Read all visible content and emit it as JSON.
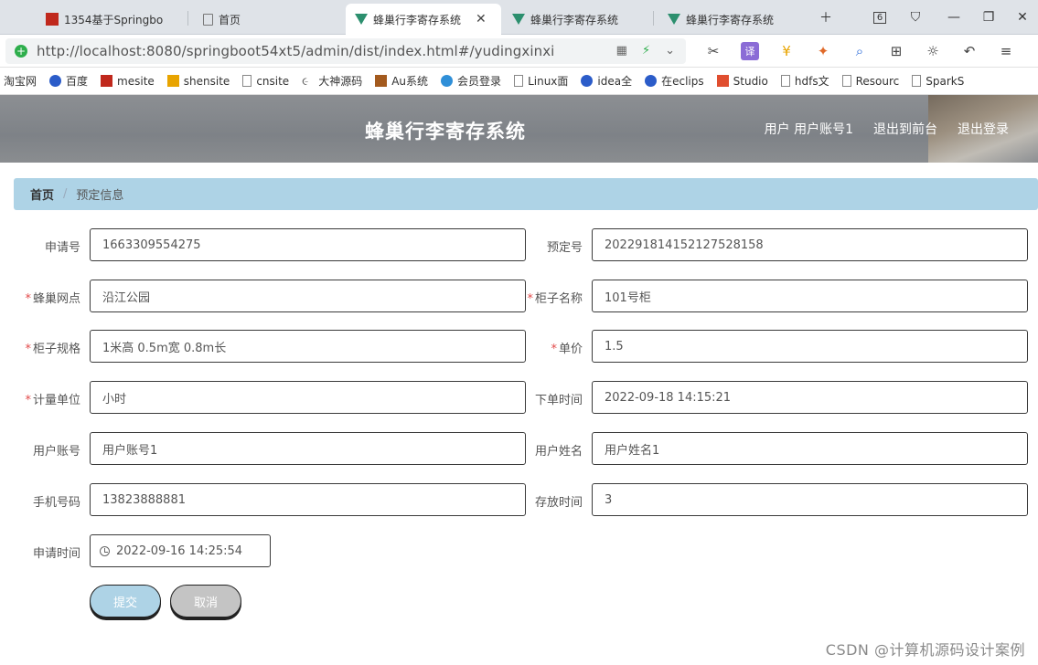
{
  "browser": {
    "tabs": [
      {
        "title": "1354基于Springbo",
        "icon": "red-square-icon",
        "active": false
      },
      {
        "title": "首页",
        "icon": "page-icon",
        "active": false
      },
      {
        "title": "蜂巢行李寄存系统",
        "icon": "vue-logo-icon",
        "active": true
      },
      {
        "title": "蜂巢行李寄存系统",
        "icon": "vue-logo-icon",
        "active": false
      },
      {
        "title": "蜂巢行李寄存系统",
        "icon": "vue-logo-icon",
        "active": false
      }
    ],
    "tab_count": "6",
    "url": "http://localhost:8080/springboot54xt5/admin/dist/index.html#/yudingxinxi",
    "bookmarks": [
      {
        "label": "淘宝网",
        "icon": ""
      },
      {
        "label": "百度",
        "icon": "paw-icon"
      },
      {
        "label": "mesite",
        "icon": "red-square-icon"
      },
      {
        "label": "shensite",
        "icon": "yellow-square-icon"
      },
      {
        "label": "cnsite",
        "icon": "page-icon"
      },
      {
        "label": "大神源码",
        "icon": "swirl-icon"
      },
      {
        "label": "Au系统",
        "icon": "brown-square-icon"
      },
      {
        "label": "会员登录",
        "icon": "cloud-icon"
      },
      {
        "label": "Linux面",
        "icon": "page-icon"
      },
      {
        "label": "idea全",
        "icon": "paw-icon"
      },
      {
        "label": "在eclips",
        "icon": "paw-icon"
      },
      {
        "label": "Studio",
        "icon": "c-icon"
      },
      {
        "label": "hdfs文",
        "icon": "page-icon"
      },
      {
        "label": "Resourc",
        "icon": "page-icon"
      },
      {
        "label": "SparkS",
        "icon": "page-icon"
      }
    ]
  },
  "header": {
    "title": "蜂巢行李寄存系统",
    "user_label": "用户 用户账号1",
    "front_link": "退出到前台",
    "logout_link": "退出登录"
  },
  "breadcrumb": {
    "home": "首页",
    "current": "预定信息"
  },
  "form": {
    "application_no": {
      "label": "申请号",
      "value": "1663309554275"
    },
    "booking_no": {
      "label": "预定号",
      "value": "202291814152127528158"
    },
    "site": {
      "label": "蜂巢网点",
      "value": "沿江公园",
      "required": "*"
    },
    "locker_name": {
      "label": "柜子名称",
      "value": "101号柜",
      "required": "*"
    },
    "locker_spec": {
      "label": "柜子规格",
      "value": "1米高 0.5m宽 0.8m长",
      "required": "*"
    },
    "unit_price": {
      "label": "单价",
      "value": "1.5",
      "required": "*"
    },
    "unit": {
      "label": "计量单位",
      "value": "小时",
      "required": "*"
    },
    "order_time": {
      "label": "下单时间",
      "value": "2022-09-18 14:15:21"
    },
    "user_account": {
      "label": "用户账号",
      "value": "用户账号1"
    },
    "user_name": {
      "label": "用户姓名",
      "value": "用户姓名1"
    },
    "phone": {
      "label": "手机号码",
      "value": "13823888881"
    },
    "storage_time": {
      "label": "存放时间",
      "value": "3"
    },
    "apply_time": {
      "label": "申请时间",
      "value": "2022-09-16 14:25:54"
    }
  },
  "buttons": {
    "submit": "提交",
    "cancel": "取消"
  },
  "watermark": "CSDN @计算机源码设计案例",
  "colors": {
    "header_bg": "#858a8f",
    "breadcrumb_bg": "#aed3e6",
    "submit_bg": "#aed3e6",
    "cancel_bg": "#c4c4c4",
    "required": "#e24a4a"
  }
}
